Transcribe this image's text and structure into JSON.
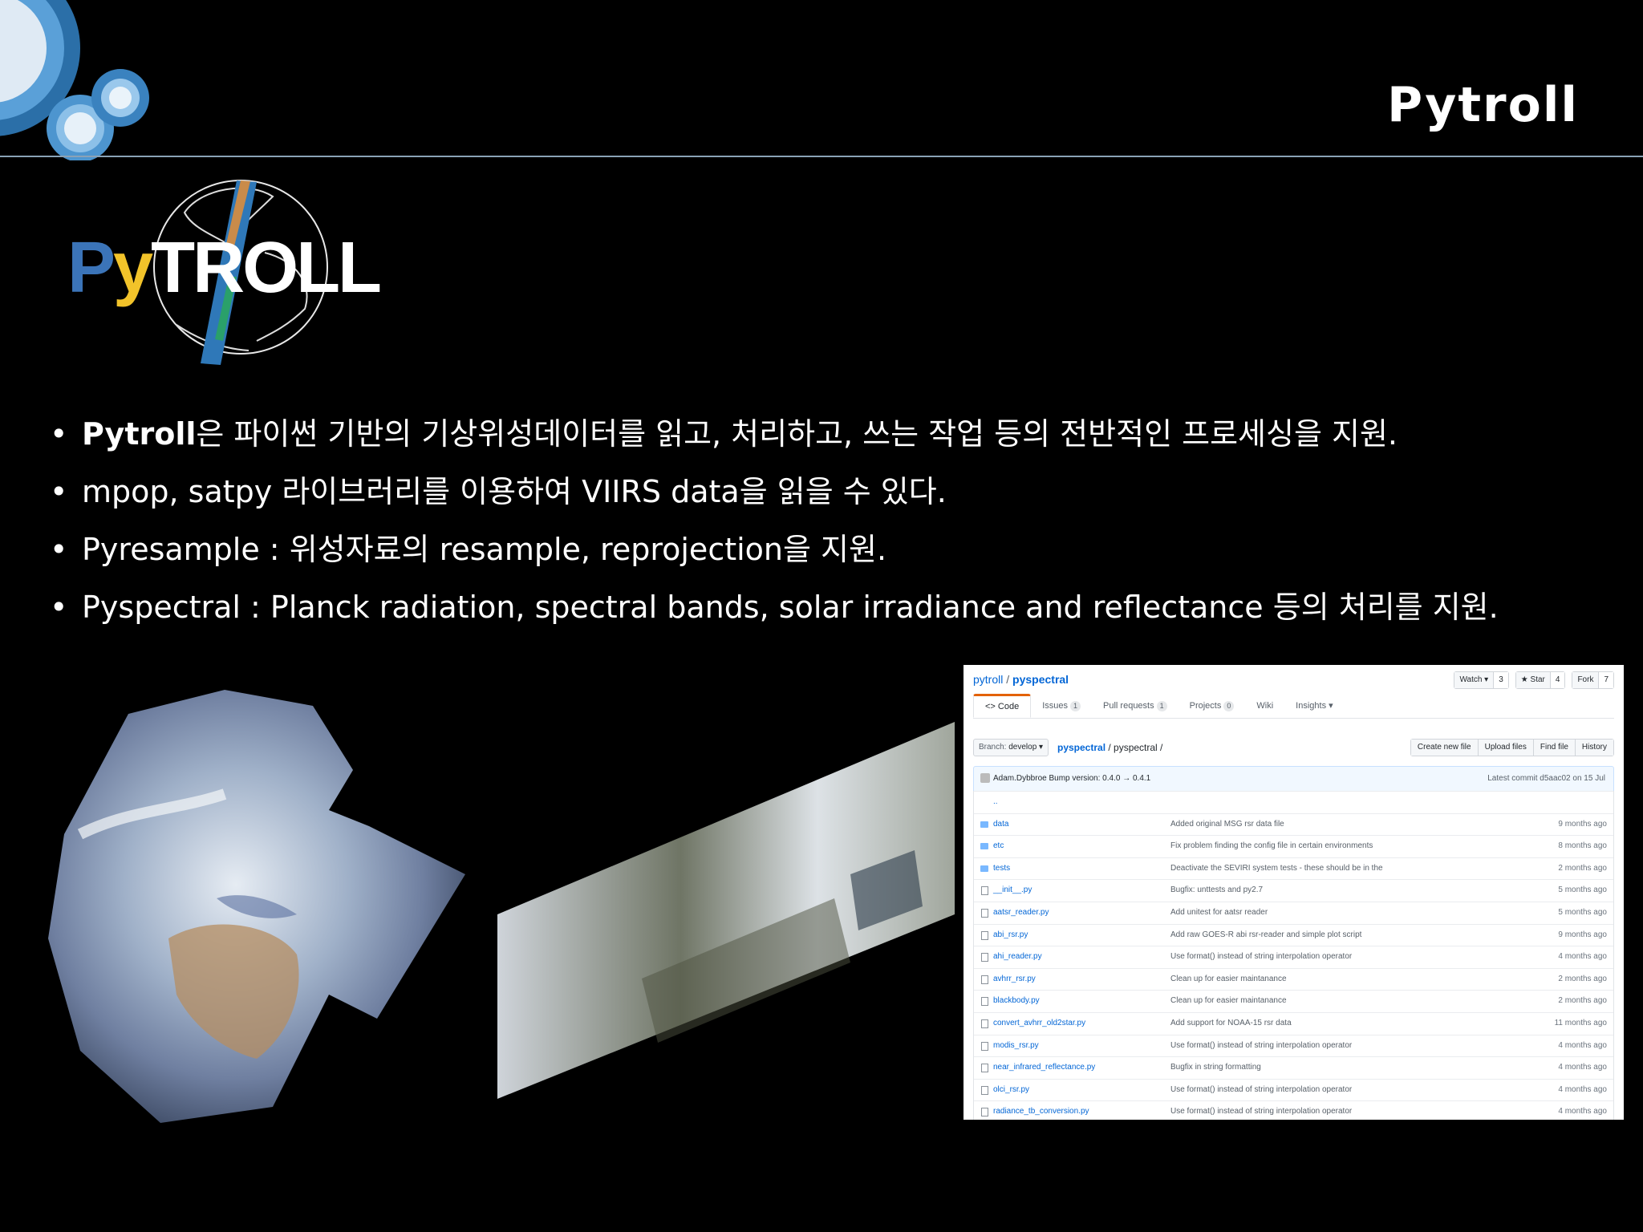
{
  "slide": {
    "title": "Pytroll"
  },
  "logo": {
    "p": "P",
    "y": "y",
    "rest": "TROLL"
  },
  "bullets": [
    {
      "bold": "Pytroll",
      "text": "은 파이썬 기반의 기상위성데이터를 읽고, 처리하고, 쓰는 작업 등의 전반적인 프로세싱을 지원."
    },
    {
      "bold": "",
      "text": "mpop, satpy 라이브러리를 이용하여 VIIRS data을 읽을 수 있다."
    },
    {
      "bold": "",
      "text": "Pyresample : 위성자료의 resample, reprojection을 지원."
    },
    {
      "bold": "",
      "text": "Pyspectral : Planck radiation, spectral bands, solar irradiance and reflectance 등의 처리를 지원."
    }
  ],
  "github": {
    "owner": "pytroll",
    "sep": "/",
    "repo": "pyspectral",
    "watch": {
      "label": "Watch ▾",
      "count": "3"
    },
    "star": {
      "label": "★ Star",
      "count": "4"
    },
    "fork": {
      "label": "Fork",
      "count": "7"
    },
    "tabs": [
      {
        "label": "<> Code",
        "count": ""
      },
      {
        "label": "Issues",
        "count": "1"
      },
      {
        "label": "Pull requests",
        "count": "1"
      },
      {
        "label": "Projects",
        "count": "0"
      },
      {
        "label": "Wiki",
        "count": ""
      },
      {
        "label": "Insights ▾",
        "count": ""
      }
    ],
    "branch_label": "Branch:",
    "branch": "develop ▾",
    "crumb_repo": "pyspectral",
    "crumb_rest": " / pyspectral /",
    "file_buttons": [
      "Create new file",
      "Upload files",
      "Find file",
      "History"
    ],
    "commit_author": "Adam.Dybbroe",
    "commit_msg": "Bump version: 0.4.0 → 0.4.1",
    "latest_commit": "Latest commit d5aac02 on 15 Jul",
    "parent": "..",
    "files": [
      {
        "name": "data",
        "type": "dir",
        "msg": "Added original MSG rsr data file",
        "age": "9 months ago"
      },
      {
        "name": "etc",
        "type": "dir",
        "msg": "Fix problem finding the config file in certain environments",
        "age": "8 months ago"
      },
      {
        "name": "tests",
        "type": "dir",
        "msg": "Deactivate the SEVIRI system tests - these should be in the",
        "age": "2 months ago"
      },
      {
        "name": "__init__.py",
        "type": "file",
        "msg": "Bugfix: unttests and py2.7",
        "age": "5 months ago"
      },
      {
        "name": "aatsr_reader.py",
        "type": "file",
        "msg": "Add unitest for aatsr reader",
        "age": "5 months ago"
      },
      {
        "name": "abi_rsr.py",
        "type": "file",
        "msg": "Add raw GOES-R abi rsr-reader and simple plot script",
        "age": "9 months ago"
      },
      {
        "name": "ahi_reader.py",
        "type": "file",
        "msg": "Use format() instead of string interpolation operator",
        "age": "4 months ago"
      },
      {
        "name": "avhrr_rsr.py",
        "type": "file",
        "msg": "Clean up for easier maintanance",
        "age": "2 months ago"
      },
      {
        "name": "blackbody.py",
        "type": "file",
        "msg": "Clean up for easier maintanance",
        "age": "2 months ago"
      },
      {
        "name": "convert_avhrr_old2star.py",
        "type": "file",
        "msg": "Add support for NOAA-15 rsr data",
        "age": "11 months ago"
      },
      {
        "name": "modis_rsr.py",
        "type": "file",
        "msg": "Use format() instead of string interpolation operator",
        "age": "4 months ago"
      },
      {
        "name": "near_infrared_reflectance.py",
        "type": "file",
        "msg": "Bugfix in string formatting",
        "age": "4 months ago"
      },
      {
        "name": "olci_rsr.py",
        "type": "file",
        "msg": "Use format() instead of string interpolation operator",
        "age": "4 months ago"
      },
      {
        "name": "radiance_tb_conversion.py",
        "type": "file",
        "msg": "Use format() instead of string interpolation operator",
        "age": "4 months ago"
      }
    ]
  }
}
